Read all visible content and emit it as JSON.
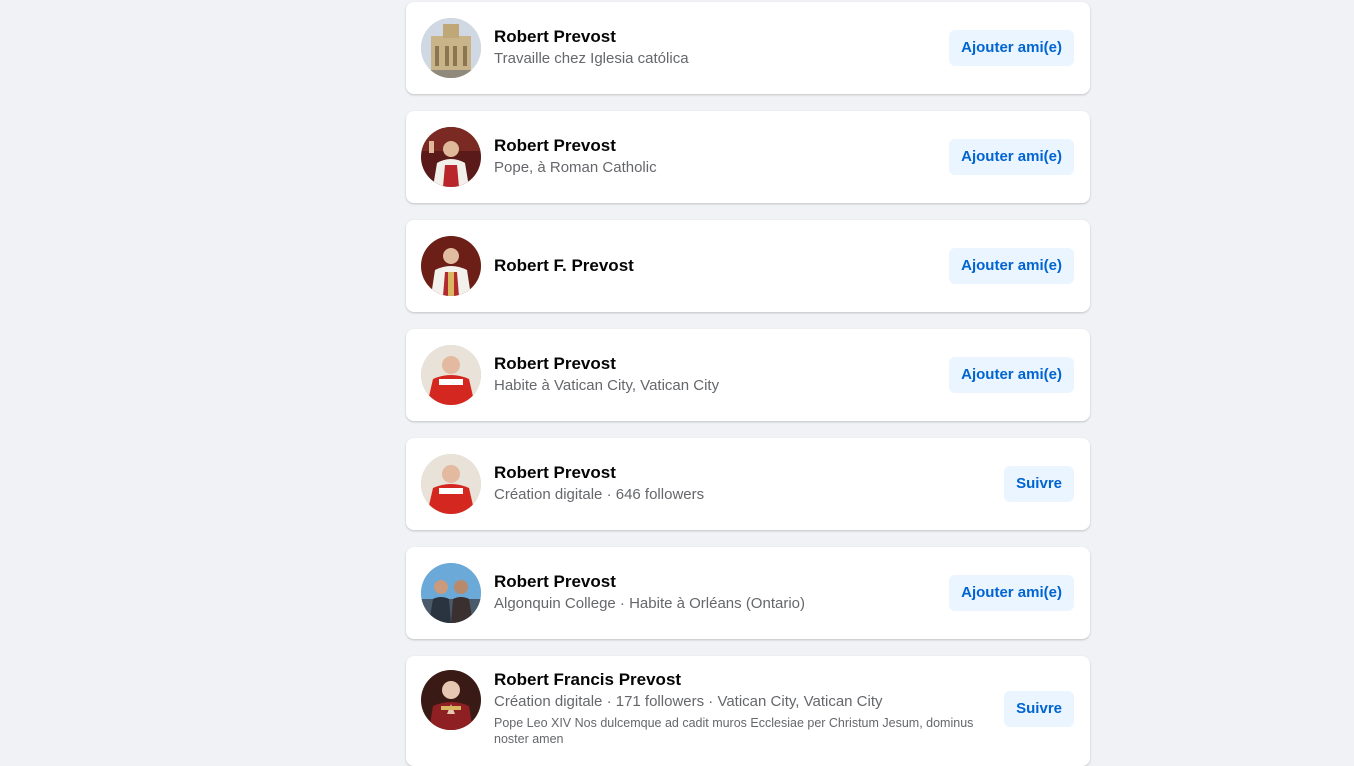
{
  "results": [
    {
      "name": "Robert Prevost",
      "subtitle": "Travaille chez Iglesia católica",
      "description": "",
      "action": "Ajouter ami(e)",
      "avatar": "church-building-photo"
    },
    {
      "name": "Robert Prevost",
      "subtitle": "Pope, à Roman Catholic",
      "description": "",
      "action": "Ajouter ami(e)",
      "avatar": "pope-waving-photo"
    },
    {
      "name": "Robert F. Prevost",
      "subtitle": "",
      "description": "",
      "action": "Ajouter ami(e)",
      "avatar": "pope-portrait-photo"
    },
    {
      "name": "Robert Prevost",
      "subtitle": "Habite à Vatican City, Vatican City",
      "description": "",
      "action": "Ajouter ami(e)",
      "avatar": "cardinal-red-photo"
    },
    {
      "name": "Robert Prevost",
      "subtitle": "Création digitale · 646 followers",
      "description": "",
      "action": "Suivre",
      "avatar": "cardinal-red-photo"
    },
    {
      "name": "Robert Prevost",
      "subtitle": "Algonquin College · Habite à Orléans (Ontario)",
      "description": "",
      "action": "Ajouter ami(e)",
      "avatar": "couple-outdoor-photo"
    },
    {
      "name": "Robert Francis Prevost",
      "subtitle": "Création digitale · 171 followers · Vatican City, Vatican City",
      "description": "Pope Leo XIV Nos dulcemque ad cadit muros Ecclesiae per Christum Jesum, dominus noster amen",
      "action": "Suivre",
      "avatar": "pope-praying-photo"
    }
  ],
  "colors": {
    "page_background": "#f0f2f5",
    "card_background": "#ffffff",
    "button_background": "#ebf5ff",
    "button_text": "#0064d1"
  }
}
